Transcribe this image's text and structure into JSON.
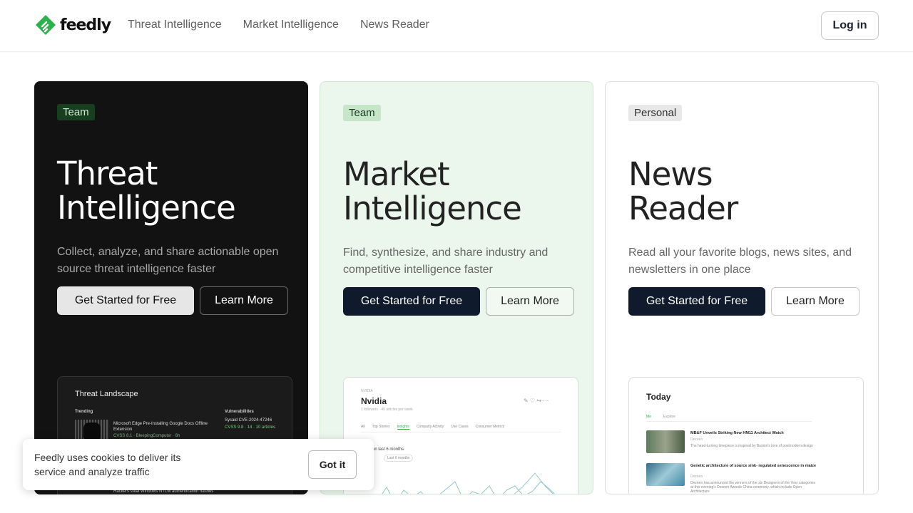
{
  "header": {
    "logo_text": "feedly",
    "nav": [
      "Threat Intelligence",
      "Market Intelligence",
      "News Reader"
    ],
    "login_label": "Log in"
  },
  "cards": [
    {
      "badge": "Team",
      "title_line1": "Threat",
      "title_line2": "Intelligence",
      "description": "Collect, analyze, and share actionable open source threat intelligence faster",
      "primary_label": "Get Started for Free",
      "secondary_label": "Learn More",
      "preview": {
        "title": "Threat Landscape",
        "col1_heading": "Trending",
        "item1": "Microsoft Edge Pre-Installing Google Docs Offline Extension",
        "item1_meta": "CVSS 8.1 · BleepingComputer · 6h",
        "item2": "Hackers steal Windows NTLM authentication hashes",
        "col2_heading": "Vulnerabilities",
        "vuln_line": "Sysaid CVE-2024-47246",
        "vuln_meta": "CVSS 9.8 · 14 · 10 articles"
      }
    },
    {
      "badge": "Team",
      "title_line1": "Market",
      "title_line2": "Intelligence",
      "description": "Find, synthesize, and share industry and competitive intelligence faster",
      "primary_label": "Get Started for Free",
      "secondary_label": "Learn More",
      "preview": {
        "kicker": "NVIDIA",
        "title": "Nvidia",
        "subtitle": "1 followers · 45 articles per week",
        "tabs": [
          "All",
          "Top Stories",
          "Insights",
          "Company Activity",
          "Use Cases",
          "Consumer Metrics"
        ],
        "range_label": "on last 6 months",
        "filter1": "Last 6 months"
      }
    },
    {
      "badge": "Personal",
      "title_line1": "News",
      "title_line2": "Reader",
      "description": "Read all your favorite blogs, news sites, and newsletters in one place",
      "primary_label": "Get Started for Free",
      "secondary_label": "Learn More",
      "preview": {
        "title": "Today",
        "tabs": [
          "Me",
          "Explore"
        ],
        "article1_title": "MB&F Unveils Striking New HM11 Architect Watch",
        "article1_source": "Dezeen",
        "article1_snippet": "The head-turning timepiece is inspired by Buxton's love of postmodern design",
        "article2_title": "Genetic architecture of source sink- regulated senescence in maize",
        "article2_source": "Dezeen",
        "article2_snippet": "Dezeen has announced the winners of the six Designers of the Year categories at this evening's Dezeen Awards China ceremony, which include Open Architecture"
      }
    }
  ],
  "cookie": {
    "text": "Feedly uses cookies to deliver its service and analyze traffic",
    "button_label": "Got it"
  },
  "colors": {
    "brand_green": "#2bb24c",
    "dark_card": "#121212",
    "green_card": "#ebf7ec",
    "navy_button": "#0f1a2c"
  }
}
